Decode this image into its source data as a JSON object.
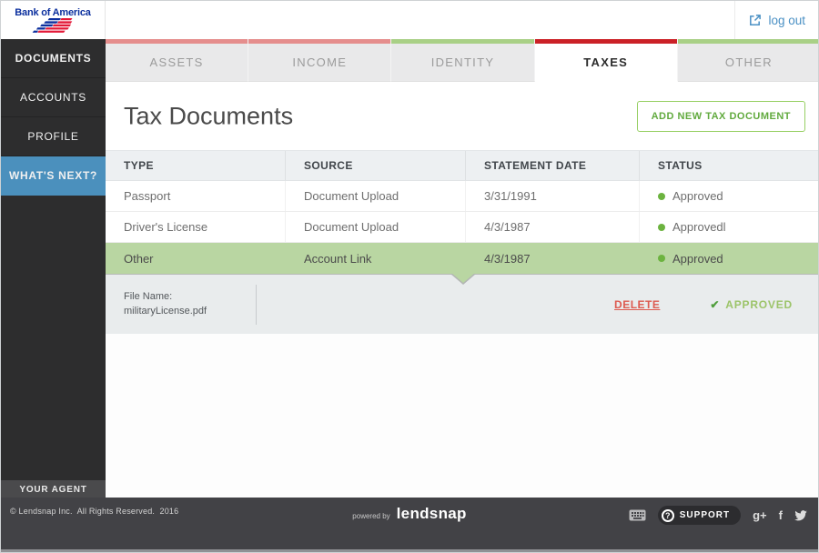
{
  "header": {
    "logo_text": "Bank of America",
    "logout_label": "log out"
  },
  "sidebar": {
    "items": [
      {
        "label": "DOCUMENTS"
      },
      {
        "label": "ACCOUNTS"
      },
      {
        "label": "PROFILE"
      },
      {
        "label": "WHAT'S NEXT?"
      }
    ],
    "agent_label": "YOUR AGENT"
  },
  "tabs": [
    {
      "label": "ASSETS",
      "strip_color": "#e58e8d",
      "active": false
    },
    {
      "label": "INCOME",
      "strip_color": "#e58e8d",
      "active": false
    },
    {
      "label": "IDENTITY",
      "strip_color": "#a9d086",
      "active": false
    },
    {
      "label": "TAXES",
      "strip_color": "#cb2127",
      "active": true
    },
    {
      "label": "OTHER",
      "strip_color": "#a9d086",
      "active": false
    }
  ],
  "main": {
    "title": "Tax Documents",
    "add_button_label": "ADD NEW TAX DOCUMENT",
    "table": {
      "columns": [
        "TYPE",
        "SOURCE",
        "STATEMENT DATE",
        "STATUS"
      ],
      "rows": [
        {
          "type": "Passport",
          "source": "Document Upload",
          "date": "3/31/1991",
          "status": "Approved",
          "selected": false
        },
        {
          "type": "Driver's License",
          "source": "Document Upload",
          "date": "4/3/1987",
          "status": "Approvedl",
          "selected": false
        },
        {
          "type": "Other",
          "source": "Account Link",
          "date": "4/3/1987",
          "status": "Approved",
          "selected": true
        }
      ]
    },
    "detail": {
      "file_label": "File Name:",
      "file_name": "militaryLicense.pdf",
      "delete_label": "DELETE",
      "approved_check": "✔",
      "approved_label": "APPROVED"
    }
  },
  "footer": {
    "copyright": "© Lendsnap Inc.  All Rights Reserved.  2016",
    "powered_by_label": "powered by",
    "brand": "lendsnap",
    "support_label": "SUPPORT",
    "question_mark": "?",
    "google_plus": "g+",
    "facebook": "f"
  },
  "colors": {
    "accent_blue": "#4b90bd",
    "logout_blue": "#4a90c4",
    "selected_row_green": "#b9d6a2",
    "status_dot_green": "#6cb33f",
    "delete_red": "#dd5a50",
    "approved_green": "#9cc469",
    "approved_check_green": "#4f9e3c",
    "button_green_border": "#97cf63",
    "button_green_text": "#61aa3e",
    "tab_active_red": "#cb2127",
    "tab_muted_red": "#e58e8d",
    "tab_muted_green": "#a9d086",
    "boa_blue": "#0b2f9e",
    "boa_red": "#e31837"
  }
}
